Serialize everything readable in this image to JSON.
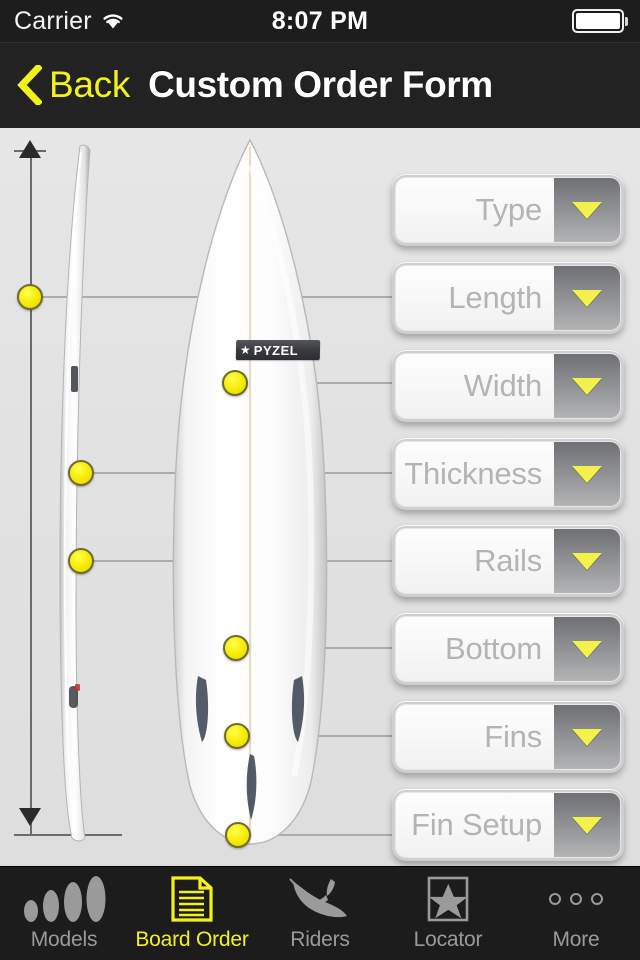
{
  "status_bar": {
    "carrier": "Carrier",
    "wifi_icon": "wifi-icon",
    "time": "8:07 PM",
    "battery_icon": "battery-full-icon"
  },
  "nav_bar": {
    "back_label": "Back",
    "back_chevron_icon": "chevron-left-icon",
    "title": "Custom Order Form",
    "accent_color": "#f2f21a",
    "background_color": "#222222"
  },
  "board": {
    "brand_star": "★",
    "brand_text": "PYZEL",
    "views": {
      "side_profile": "surfboard-side-profile",
      "top_view": "surfboard-top-view"
    },
    "length_dimension_icon": "length-dimension-arrow"
  },
  "form": {
    "options": [
      {
        "label": "Type",
        "marker": false
      },
      {
        "label": "Length",
        "marker": true
      },
      {
        "label": "Width",
        "marker": true
      },
      {
        "label": "Thickness",
        "marker": true
      },
      {
        "label": "Rails",
        "marker": true
      },
      {
        "label": "Bottom",
        "marker": true
      },
      {
        "label": "Fins",
        "marker": true
      },
      {
        "label": "Fin Setup",
        "marker": true
      }
    ],
    "arrow_icon": "chevron-down-icon",
    "arrow_color": "#f4f14a"
  },
  "tab_bar": {
    "items": [
      {
        "label": "Models",
        "icon": "surfboards-icon",
        "active": false
      },
      {
        "label": "Board Order",
        "icon": "document-icon",
        "active": true
      },
      {
        "label": "Riders",
        "icon": "surfer-icon",
        "active": false
      },
      {
        "label": "Locator",
        "icon": "star-box-icon",
        "active": false
      },
      {
        "label": "More",
        "icon": "ellipsis-icon",
        "active": false
      }
    ],
    "active_color": "#f2f21a",
    "inactive_color": "#9a9a9a"
  }
}
